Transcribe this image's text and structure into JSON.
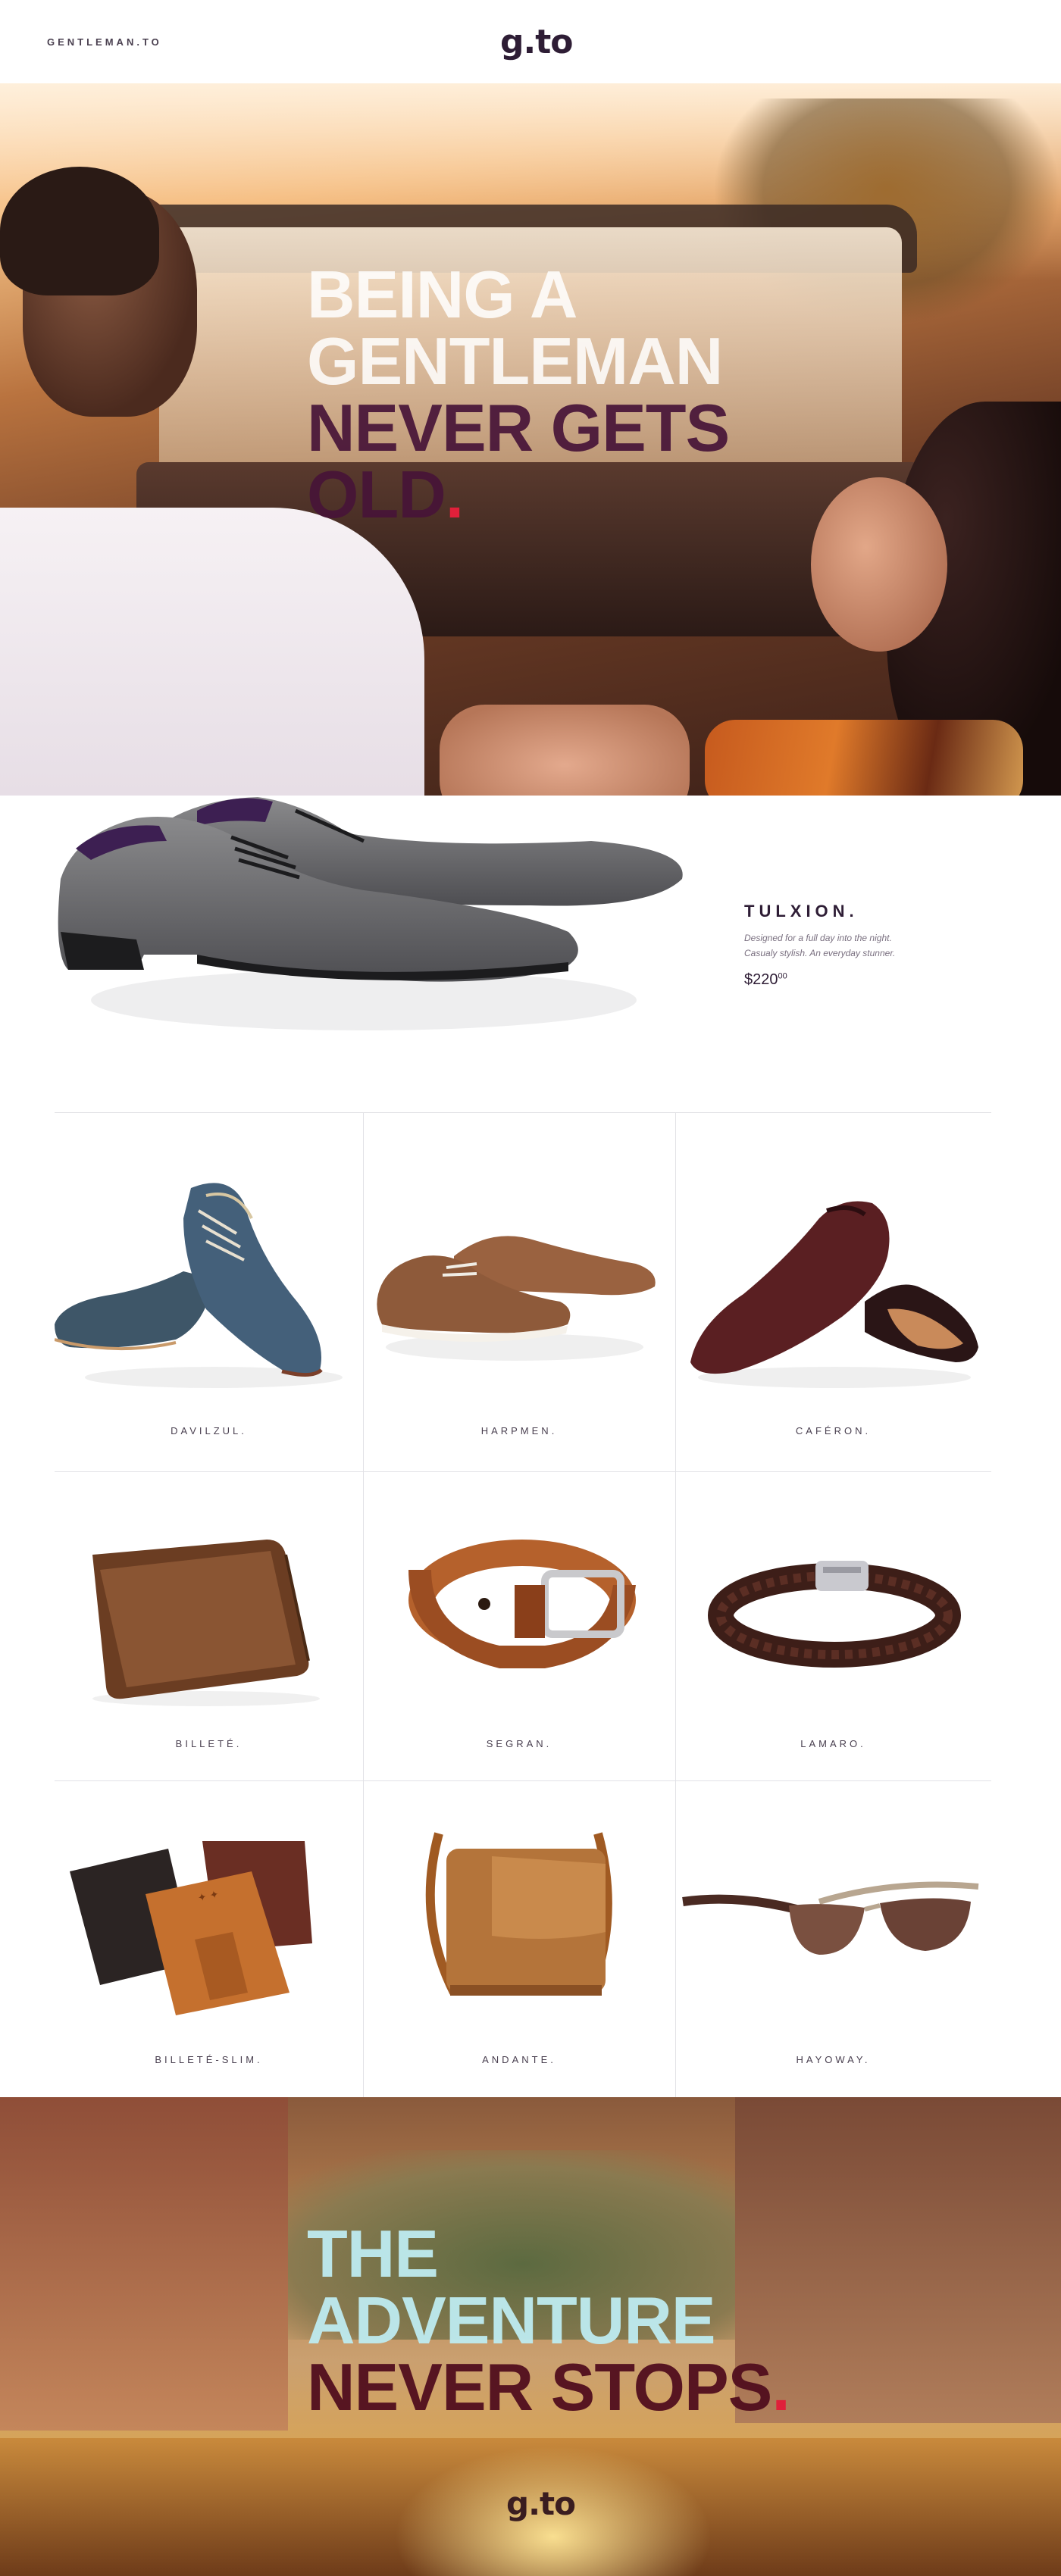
{
  "header": {
    "brand_text": "GENTLEMAN.TO",
    "logo": "g.to"
  },
  "hero": {
    "title_light": [
      "BEING A",
      "GENTLEMAN"
    ],
    "title_dark": [
      "NEVER GETS",
      "OLD"
    ],
    "title_dot": ".",
    "dot_color": "#e0203a"
  },
  "featured": {
    "name": "TULXION.",
    "description_line1": "Designed for a full day into the night.",
    "description_line2": "Casualy stylish. An everyday stunner.",
    "price_main": "$220",
    "price_cents": "00"
  },
  "products": [
    {
      "label": "DAVILZUL."
    },
    {
      "label": "HARPMEN."
    },
    {
      "label": "CAFÉRON."
    },
    {
      "label": "BILLETÉ."
    },
    {
      "label": "SEGRAN."
    },
    {
      "label": "LAMARO."
    },
    {
      "label": "BILLETÉ-SLIM."
    },
    {
      "label": "ANDANTE."
    },
    {
      "label": "HAYOWAY."
    }
  ],
  "footer": {
    "title_light": [
      "THE",
      "ADVENTURE"
    ],
    "title_dark": "NEVER STOPS",
    "title_dot": ".",
    "logo": "g.to"
  }
}
